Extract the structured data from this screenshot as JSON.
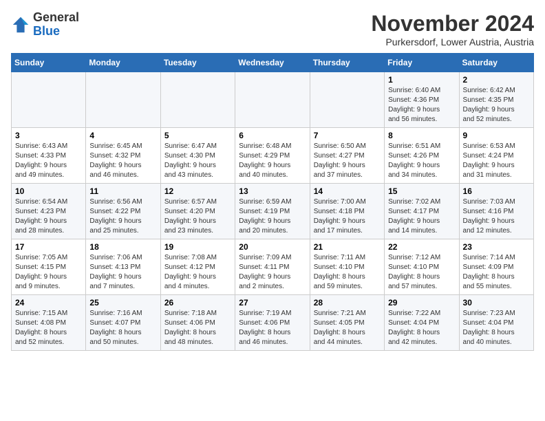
{
  "logo": {
    "general": "General",
    "blue": "Blue"
  },
  "header": {
    "title": "November 2024",
    "subtitle": "Purkersdorf, Lower Austria, Austria"
  },
  "weekdays": [
    "Sunday",
    "Monday",
    "Tuesday",
    "Wednesday",
    "Thursday",
    "Friday",
    "Saturday"
  ],
  "weeks": [
    [
      {
        "day": "",
        "info": ""
      },
      {
        "day": "",
        "info": ""
      },
      {
        "day": "",
        "info": ""
      },
      {
        "day": "",
        "info": ""
      },
      {
        "day": "",
        "info": ""
      },
      {
        "day": "1",
        "info": "Sunrise: 6:40 AM\nSunset: 4:36 PM\nDaylight: 9 hours\nand 56 minutes."
      },
      {
        "day": "2",
        "info": "Sunrise: 6:42 AM\nSunset: 4:35 PM\nDaylight: 9 hours\nand 52 minutes."
      }
    ],
    [
      {
        "day": "3",
        "info": "Sunrise: 6:43 AM\nSunset: 4:33 PM\nDaylight: 9 hours\nand 49 minutes."
      },
      {
        "day": "4",
        "info": "Sunrise: 6:45 AM\nSunset: 4:32 PM\nDaylight: 9 hours\nand 46 minutes."
      },
      {
        "day": "5",
        "info": "Sunrise: 6:47 AM\nSunset: 4:30 PM\nDaylight: 9 hours\nand 43 minutes."
      },
      {
        "day": "6",
        "info": "Sunrise: 6:48 AM\nSunset: 4:29 PM\nDaylight: 9 hours\nand 40 minutes."
      },
      {
        "day": "7",
        "info": "Sunrise: 6:50 AM\nSunset: 4:27 PM\nDaylight: 9 hours\nand 37 minutes."
      },
      {
        "day": "8",
        "info": "Sunrise: 6:51 AM\nSunset: 4:26 PM\nDaylight: 9 hours\nand 34 minutes."
      },
      {
        "day": "9",
        "info": "Sunrise: 6:53 AM\nSunset: 4:24 PM\nDaylight: 9 hours\nand 31 minutes."
      }
    ],
    [
      {
        "day": "10",
        "info": "Sunrise: 6:54 AM\nSunset: 4:23 PM\nDaylight: 9 hours\nand 28 minutes."
      },
      {
        "day": "11",
        "info": "Sunrise: 6:56 AM\nSunset: 4:22 PM\nDaylight: 9 hours\nand 25 minutes."
      },
      {
        "day": "12",
        "info": "Sunrise: 6:57 AM\nSunset: 4:20 PM\nDaylight: 9 hours\nand 23 minutes."
      },
      {
        "day": "13",
        "info": "Sunrise: 6:59 AM\nSunset: 4:19 PM\nDaylight: 9 hours\nand 20 minutes."
      },
      {
        "day": "14",
        "info": "Sunrise: 7:00 AM\nSunset: 4:18 PM\nDaylight: 9 hours\nand 17 minutes."
      },
      {
        "day": "15",
        "info": "Sunrise: 7:02 AM\nSunset: 4:17 PM\nDaylight: 9 hours\nand 14 minutes."
      },
      {
        "day": "16",
        "info": "Sunrise: 7:03 AM\nSunset: 4:16 PM\nDaylight: 9 hours\nand 12 minutes."
      }
    ],
    [
      {
        "day": "17",
        "info": "Sunrise: 7:05 AM\nSunset: 4:15 PM\nDaylight: 9 hours\nand 9 minutes."
      },
      {
        "day": "18",
        "info": "Sunrise: 7:06 AM\nSunset: 4:13 PM\nDaylight: 9 hours\nand 7 minutes."
      },
      {
        "day": "19",
        "info": "Sunrise: 7:08 AM\nSunset: 4:12 PM\nDaylight: 9 hours\nand 4 minutes."
      },
      {
        "day": "20",
        "info": "Sunrise: 7:09 AM\nSunset: 4:11 PM\nDaylight: 9 hours\nand 2 minutes."
      },
      {
        "day": "21",
        "info": "Sunrise: 7:11 AM\nSunset: 4:10 PM\nDaylight: 8 hours\nand 59 minutes."
      },
      {
        "day": "22",
        "info": "Sunrise: 7:12 AM\nSunset: 4:10 PM\nDaylight: 8 hours\nand 57 minutes."
      },
      {
        "day": "23",
        "info": "Sunrise: 7:14 AM\nSunset: 4:09 PM\nDaylight: 8 hours\nand 55 minutes."
      }
    ],
    [
      {
        "day": "24",
        "info": "Sunrise: 7:15 AM\nSunset: 4:08 PM\nDaylight: 8 hours\nand 52 minutes."
      },
      {
        "day": "25",
        "info": "Sunrise: 7:16 AM\nSunset: 4:07 PM\nDaylight: 8 hours\nand 50 minutes."
      },
      {
        "day": "26",
        "info": "Sunrise: 7:18 AM\nSunset: 4:06 PM\nDaylight: 8 hours\nand 48 minutes."
      },
      {
        "day": "27",
        "info": "Sunrise: 7:19 AM\nSunset: 4:06 PM\nDaylight: 8 hours\nand 46 minutes."
      },
      {
        "day": "28",
        "info": "Sunrise: 7:21 AM\nSunset: 4:05 PM\nDaylight: 8 hours\nand 44 minutes."
      },
      {
        "day": "29",
        "info": "Sunrise: 7:22 AM\nSunset: 4:04 PM\nDaylight: 8 hours\nand 42 minutes."
      },
      {
        "day": "30",
        "info": "Sunrise: 7:23 AM\nSunset: 4:04 PM\nDaylight: 8 hours\nand 40 minutes."
      }
    ]
  ]
}
